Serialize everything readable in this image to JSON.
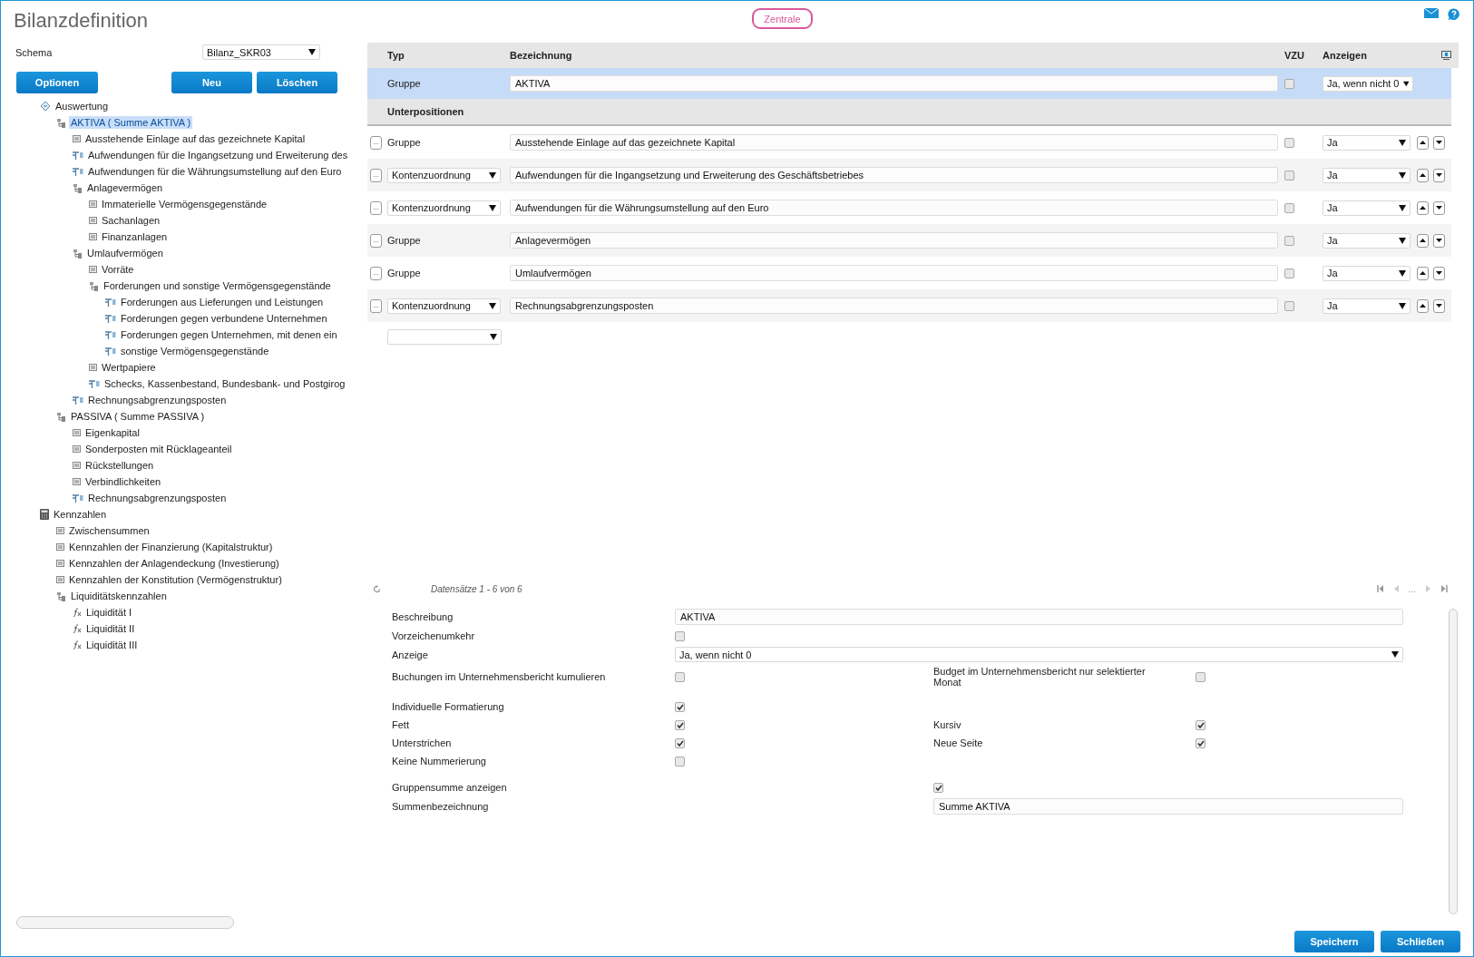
{
  "header": {
    "title": "Bilanzdefinition",
    "badge": "Zentrale"
  },
  "schema": {
    "label": "Schema",
    "value": "Bilanz_SKR03"
  },
  "left_buttons": [
    "Optionen",
    "Neu",
    "Löschen"
  ],
  "tree": [
    {
      "label": "Auswertung",
      "kind": "root",
      "selected": false,
      "children": [
        {
          "label": "AKTIVA ( Summe AKTIVA )",
          "kind": "group",
          "selected": true,
          "children": [
            {
              "label": "Ausstehende Einlage auf das gezeichnete Kapital",
              "kind": "item",
              "selected": false
            },
            {
              "label": "Aufwendungen für die Ingangsetzung und Erweiterung des",
              "kind": "account",
              "selected": false
            },
            {
              "label": "Aufwendungen für die Währungsumstellung auf den Euro",
              "kind": "account",
              "selected": false
            },
            {
              "label": "Anlagevermögen",
              "kind": "group",
              "selected": false,
              "children": [
                {
                  "label": "Immaterielle Vermögensgegenstände",
                  "kind": "item",
                  "selected": false
                },
                {
                  "label": "Sachanlagen",
                  "kind": "item",
                  "selected": false
                },
                {
                  "label": "Finanzanlagen",
                  "kind": "item",
                  "selected": false
                }
              ]
            },
            {
              "label": "Umlaufvermögen",
              "kind": "group",
              "selected": false,
              "children": [
                {
                  "label": "Vorräte",
                  "kind": "item",
                  "selected": false
                },
                {
                  "label": "Forderungen und sonstige Vermögensgegenstände",
                  "kind": "group",
                  "selected": false,
                  "children": [
                    {
                      "label": "Forderungen aus Lieferungen und Leistungen",
                      "kind": "account",
                      "selected": false
                    },
                    {
                      "label": "Forderungen gegen verbundene Unternehmen",
                      "kind": "account",
                      "selected": false
                    },
                    {
                      "label": "Forderungen gegen Unternehmen, mit denen ein",
                      "kind": "account",
                      "selected": false
                    },
                    {
                      "label": "sonstige Vermögensgegenstände",
                      "kind": "account",
                      "selected": false
                    }
                  ]
                },
                {
                  "label": "Wertpapiere",
                  "kind": "item",
                  "selected": false
                },
                {
                  "label": "Schecks, Kassenbestand, Bundesbank- und Postgirog",
                  "kind": "account",
                  "selected": false
                }
              ]
            },
            {
              "label": "Rechnungsabgrenzungsposten",
              "kind": "account",
              "selected": false
            }
          ]
        },
        {
          "label": "PASSIVA ( Summe PASSIVA )",
          "kind": "group",
          "selected": false,
          "children": [
            {
              "label": "Eigenkapital",
              "kind": "item",
              "selected": false
            },
            {
              "label": "Sonderposten mit Rücklageanteil",
              "kind": "item",
              "selected": false
            },
            {
              "label": "Rückstellungen",
              "kind": "item",
              "selected": false
            },
            {
              "label": "Verbindlichkeiten",
              "kind": "item",
              "selected": false
            },
            {
              "label": "Rechnungsabgrenzungsposten",
              "kind": "account",
              "selected": false
            }
          ]
        }
      ]
    },
    {
      "label": "Kennzahlen",
      "kind": "calc",
      "selected": false,
      "children": [
        {
          "label": "Zwischensummen",
          "kind": "item",
          "selected": false
        },
        {
          "label": "Kennzahlen der Finanzierung (Kapitalstruktur)",
          "kind": "item",
          "selected": false
        },
        {
          "label": "Kennzahlen der Anlagendeckung (Investierung)",
          "kind": "item",
          "selected": false
        },
        {
          "label": "Kennzahlen der Konstitution (Vermögenstruktur)",
          "kind": "item",
          "selected": false
        },
        {
          "label": "Liquiditätskennzahlen",
          "kind": "group",
          "selected": false,
          "children": [
            {
              "label": "Liquidität I",
              "kind": "formula",
              "selected": false
            },
            {
              "label": "Liquidität II",
              "kind": "formula",
              "selected": false
            },
            {
              "label": "Liquidität III",
              "kind": "formula",
              "selected": false
            }
          ]
        }
      ]
    }
  ],
  "table": {
    "columns": [
      "Typ",
      "Bezeichnung",
      "VZU",
      "Anzeigen"
    ],
    "main_row": {
      "type": "Gruppe",
      "name": "AKTIVA",
      "vzu": false,
      "show": "Ja, wenn nicht 0",
      "selected": true
    },
    "section": "Unterpositionen",
    "rows": [
      {
        "kind": "fixed",
        "menu": "...",
        "type": "Gruppe",
        "name": "Ausstehende Einlage auf das gezeichnete Kapital",
        "vzu": false,
        "show": "Ja"
      },
      {
        "kind": "choice",
        "menu": "...",
        "type": "Kontenzuordnung",
        "name": "Aufwendungen für die Ingangsetzung und Erweiterung des Geschäftsbetriebes",
        "vzu": false,
        "show": "Ja"
      },
      {
        "kind": "choice",
        "menu": "...",
        "type": "Kontenzuordnung",
        "name": "Aufwendungen für die Währungsumstellung auf den Euro",
        "vzu": false,
        "show": "Ja"
      },
      {
        "kind": "fixed",
        "menu": "...",
        "type": "Gruppe",
        "name": "Anlagevermögen",
        "vzu": false,
        "show": "Ja"
      },
      {
        "kind": "fixed",
        "menu": "...",
        "type": "Gruppe",
        "name": "Umlaufvermögen",
        "vzu": false,
        "show": "Ja"
      },
      {
        "kind": "choice",
        "menu": "...",
        "type": "Kontenzuordnung",
        "name": "Rechnungsabgrenzungsposten",
        "vzu": false,
        "show": "Ja"
      }
    ]
  },
  "pager": {
    "info": "Datensätze 1 - 6 von 6",
    "ellipsis": "..."
  },
  "form": [
    [
      {
        "kind": "input",
        "label": "Beschreibung",
        "value": "AKTIVA"
      },
      {
        "kind": "check",
        "label": "Vorzeichenumkehr",
        "checked": false
      },
      {
        "kind": "dropdown",
        "label": "Anzeige",
        "value": "Ja, wenn nicht 0"
      },
      {
        "kind": "check",
        "label": "Buchungen im Unternehmensbericht kumulieren",
        "checked": false,
        "pair": {
          "label": "Budget im Unternehmensbericht nur selektierter Monat",
          "checked": false
        }
      }
    ],
    [
      {
        "kind": "check",
        "label": "Individuelle Formatierung",
        "checked": true
      },
      {
        "kind": "check",
        "label": "Fett",
        "checked": true,
        "pair": {
          "label": "Kursiv",
          "checked": true
        }
      },
      {
        "kind": "check",
        "label": "Unterstrichen",
        "checked": true,
        "pair": {
          "label": "Neue Seite",
          "checked": true
        }
      },
      {
        "kind": "check",
        "label": "Keine Nummerierung",
        "checked": false
      }
    ],
    [
      {
        "kind": "latecheck",
        "label": "Gruppensumme anzeigen",
        "checked": true
      },
      {
        "kind": "lateinput",
        "label": "Summenbezeichnung",
        "value": "Summe AKTIVA"
      }
    ]
  ],
  "footer_buttons": [
    "Speichern",
    "Schließen"
  ]
}
